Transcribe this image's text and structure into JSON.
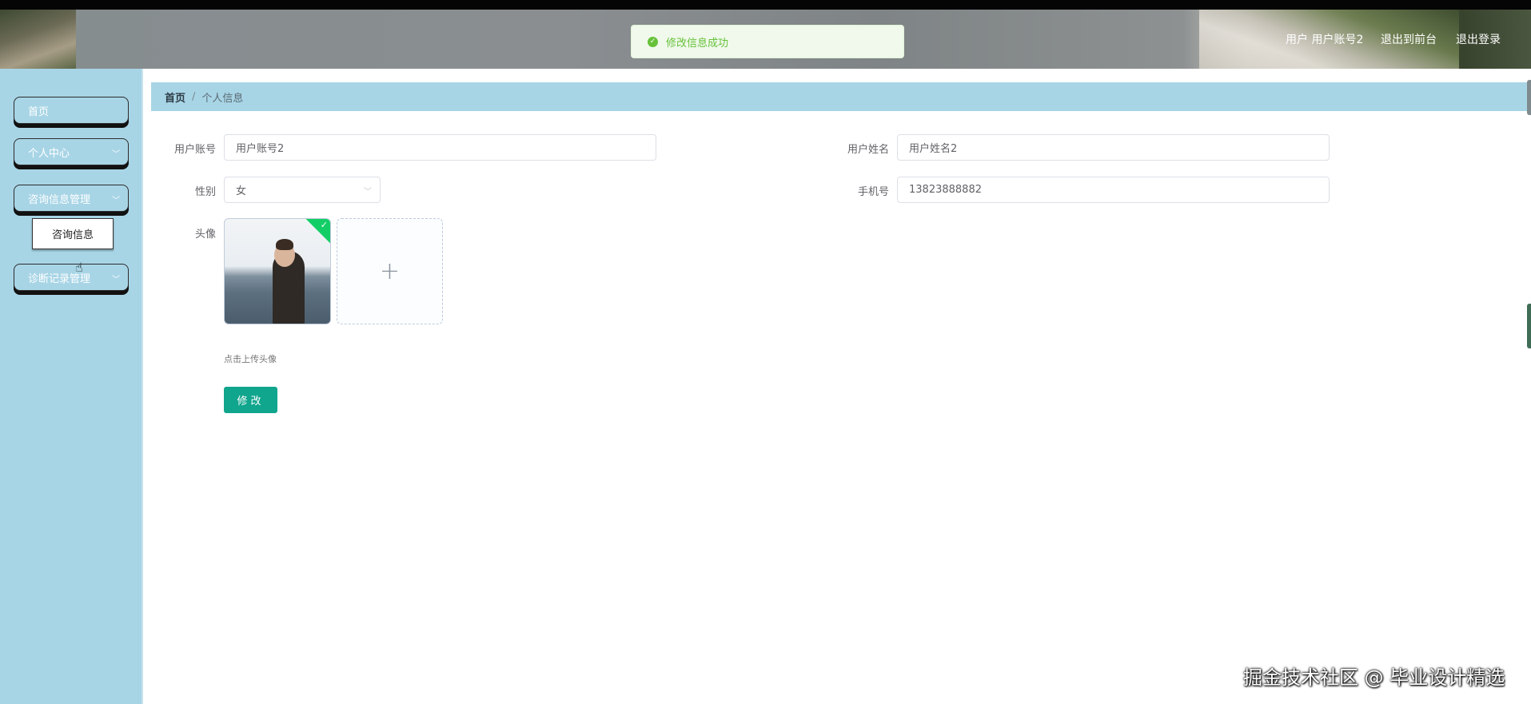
{
  "header": {
    "user_label": "用户 用户账号2",
    "back_to_front": "退出到前台",
    "logout": "退出登录"
  },
  "toast": {
    "icon": "check-circle-icon",
    "message": "修改信息成功",
    "color": "#67c23a"
  },
  "sidebar": {
    "items": [
      {
        "label": "首页",
        "has_submenu": false
      },
      {
        "label": "个人中心",
        "has_submenu": true
      },
      {
        "label": "咨询信息管理",
        "has_submenu": true,
        "expanded": true
      },
      {
        "label": "诊断记录管理",
        "has_submenu": true
      }
    ],
    "submenu_item": "咨询信息"
  },
  "breadcrumb": {
    "home": "首页",
    "separator": "/",
    "current": "个人信息"
  },
  "form": {
    "account_label": "用户账号",
    "account_value": "用户账号2",
    "name_label": "用户姓名",
    "name_value": "用户姓名2",
    "gender_label": "性别",
    "gender_value": "女",
    "phone_label": "手机号",
    "phone_value": "13823888882",
    "avatar_label": "头像",
    "upload_hint": "点击上传头像",
    "submit_label": "修改"
  },
  "watermark": "掘金技术社区 @ 毕业设计精选",
  "colors": {
    "sidebar_bg": "#a8d5e6",
    "primary_button": "#10a58d"
  }
}
